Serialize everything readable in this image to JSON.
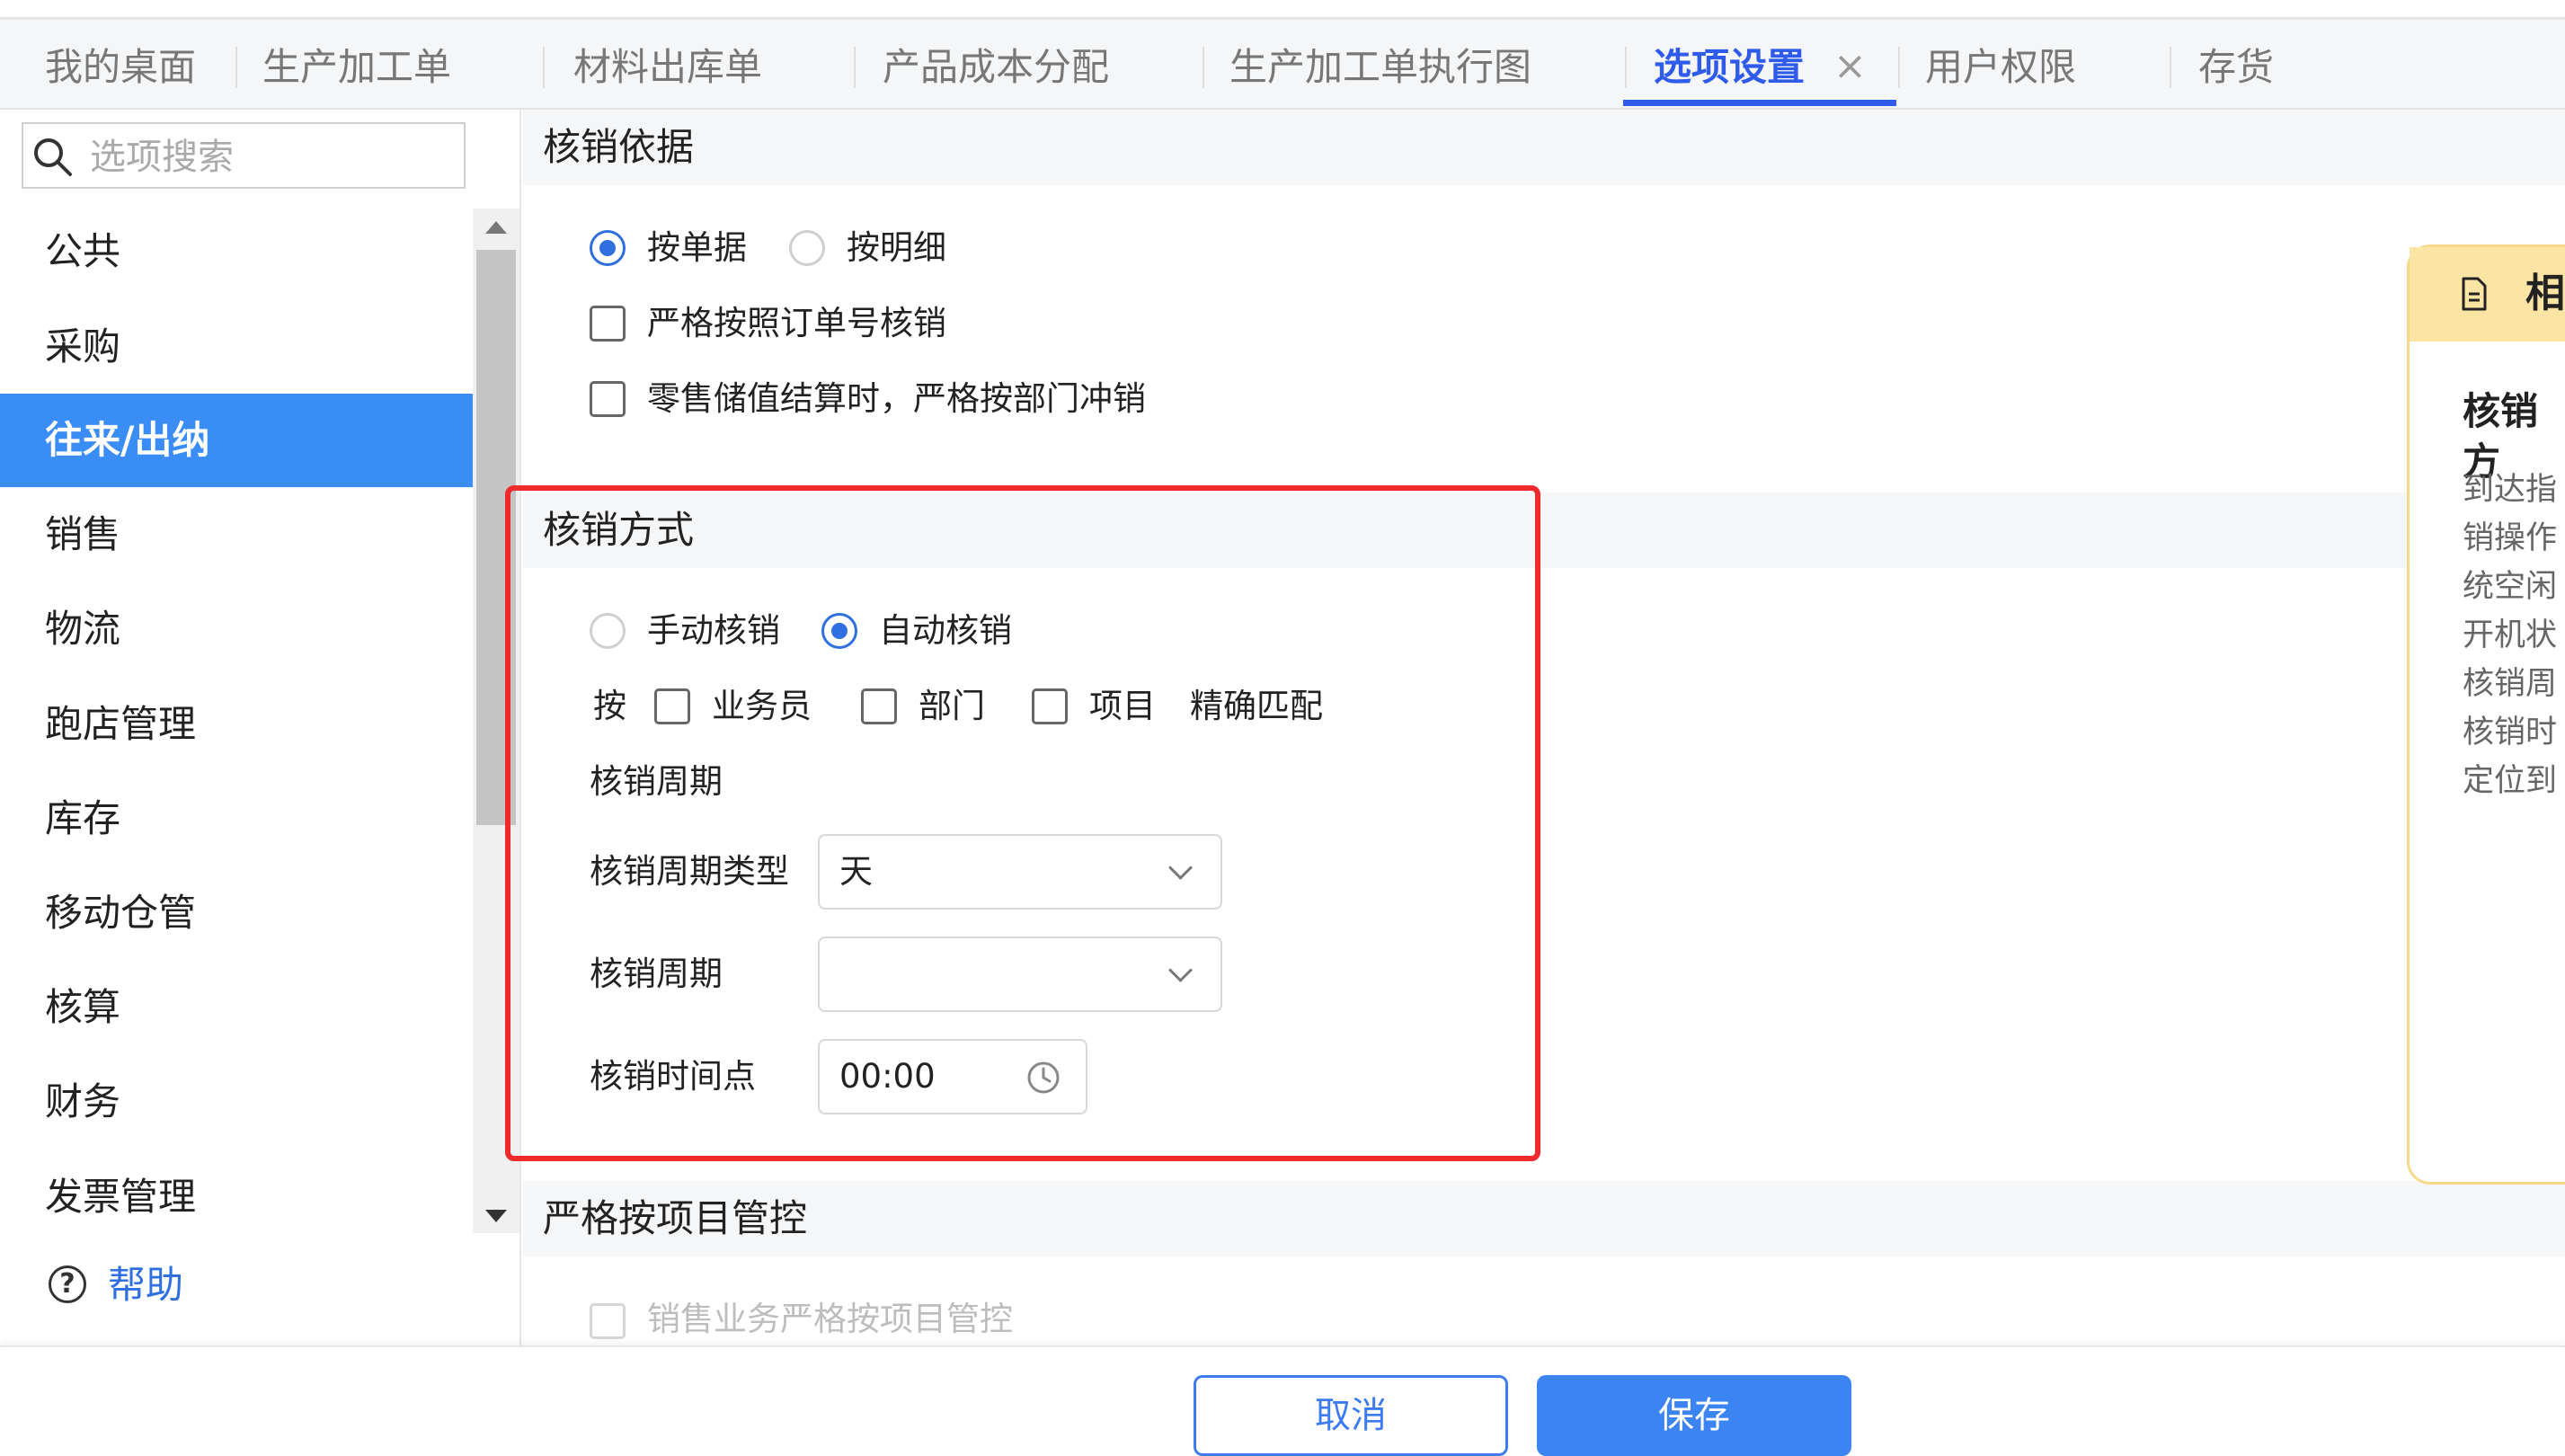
{
  "tabs": [
    {
      "label": "我的桌面"
    },
    {
      "label": "生产加工单"
    },
    {
      "label": "材料出库单"
    },
    {
      "label": "产品成本分配"
    },
    {
      "label": "生产加工单执行图"
    },
    {
      "label": "选项设置",
      "active": true
    },
    {
      "label": "用户权限"
    },
    {
      "label": "存货"
    }
  ],
  "close_icon": "×",
  "search": {
    "placeholder": "选项搜索"
  },
  "sidebar": {
    "items": [
      {
        "label": "公共"
      },
      {
        "label": "采购"
      },
      {
        "label": "往来/出纳",
        "active": true
      },
      {
        "label": "销售"
      },
      {
        "label": "物流"
      },
      {
        "label": "跑店管理"
      },
      {
        "label": "库存"
      },
      {
        "label": "移动仓管"
      },
      {
        "label": "核算"
      },
      {
        "label": "财务"
      },
      {
        "label": "发票管理"
      }
    ],
    "help_icon": "?",
    "help_label": "帮助"
  },
  "sections": {
    "basis": {
      "title": "核销依据",
      "radio_by_document": "按单据",
      "radio_by_detail": "按明细",
      "selected": "按单据",
      "check_strict_order": "严格按照订单号核销",
      "check_retail_dept": "零售储值结算时，严格按部门冲销"
    },
    "method": {
      "title": "核销方式",
      "radio_manual": "手动核销",
      "radio_auto": "自动核销",
      "selected": "自动核销",
      "match_prefix": "按",
      "check_salesperson": "业务员",
      "check_department": "部门",
      "check_project": "项目",
      "match_suffix": "精确匹配",
      "period_heading": "核销周期",
      "period_type_label": "核销周期类型",
      "period_type_value": "天",
      "period_label": "核销周期",
      "period_value": "",
      "time_label": "核销时间点",
      "time_value": "00:00"
    },
    "project": {
      "title": "严格按项目管控",
      "check_sales_project": "销售业务严格按项目管控"
    }
  },
  "help_card": {
    "title": "相",
    "subtitle": "核销方",
    "lines": [
      "到达指",
      "销操作",
      "统空闲",
      "开机状",
      "核销周",
      "核销时",
      "定位到"
    ]
  },
  "footer": {
    "cancel_label": "取消",
    "save_label": "保存"
  },
  "colors": {
    "accent": "#2f5bea",
    "sidebar_active": "#3a8df4",
    "highlight": "#ee2a2a",
    "help_card_border": "#f6d98c"
  }
}
